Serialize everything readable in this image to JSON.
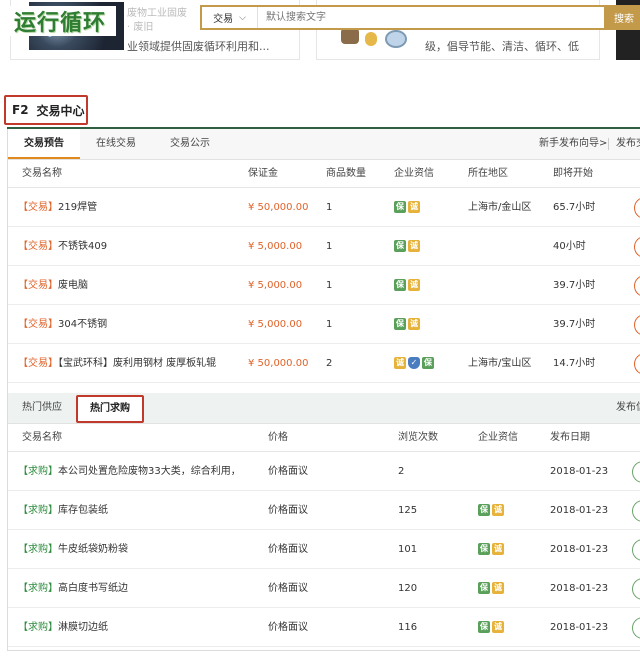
{
  "header": {
    "logo_text": "运行循环",
    "search": {
      "category": "交易",
      "placeholder": "默认搜索文字",
      "button": "搜索"
    },
    "cards": [
      {
        "faint1": "废物工业固废",
        "faint2": "·       废旧",
        "text": "业领域提供固废循环利用和..."
      },
      {
        "text": "级，倡导节能、清洁、循环、低"
      }
    ]
  },
  "section": {
    "code": "F2",
    "title": "交易中心"
  },
  "trade": {
    "tabs": [
      "交易预告",
      "在线交易",
      "交易公示"
    ],
    "right_links": [
      "新手发布向导>",
      "发布交"
    ],
    "columns": [
      "交易名称",
      "保证金",
      "商品数量",
      "企业资信",
      "所在地区",
      "即将开始"
    ],
    "rows": [
      {
        "tag": "【交易】",
        "name": "219焊管",
        "deposit": "¥ 50,000.00",
        "qty": "1",
        "badges": [
          "green",
          "gold"
        ],
        "region": "上海市/金山区",
        "start": "65.7小时"
      },
      {
        "tag": "【交易】",
        "name": "不锈铁409",
        "deposit": "¥ 5,000.00",
        "qty": "1",
        "badges": [
          "green",
          "gold"
        ],
        "region": "",
        "start": "40小时"
      },
      {
        "tag": "【交易】",
        "name": "废电脑",
        "deposit": "¥ 5,000.00",
        "qty": "1",
        "badges": [
          "green",
          "gold"
        ],
        "region": "",
        "start": "39.7小时"
      },
      {
        "tag": "【交易】",
        "name": "304不锈钢",
        "deposit": "¥ 5,000.00",
        "qty": "1",
        "badges": [
          "green",
          "gold"
        ],
        "region": "",
        "start": "39.7小时"
      },
      {
        "tag": "【交易】",
        "name": "【宝武环科】废利用钢材 废厚板轧辊",
        "deposit": "¥ 50,000.00",
        "qty": "2",
        "badges": [
          "gold",
          "shield",
          "green"
        ],
        "region": "上海市/宝山区",
        "start": "14.7小时"
      }
    ]
  },
  "hot": {
    "tabs": [
      "热门供应",
      "热门求购"
    ],
    "right_link": "发布信",
    "columns": [
      "交易名称",
      "价格",
      "浏览次数",
      "企业资信",
      "发布日期"
    ],
    "rows": [
      {
        "tag": "【求购】",
        "name": "本公司处置危险废物33大类，综合利用，",
        "price": "价格面议",
        "views": "2",
        "badges": [],
        "date": "2018-01-23"
      },
      {
        "tag": "【求购】",
        "name": "库存包装纸",
        "price": "价格面议",
        "views": "125",
        "badges": [
          "green",
          "gold"
        ],
        "date": "2018-01-23"
      },
      {
        "tag": "【求购】",
        "name": "牛皮纸袋奶粉袋",
        "price": "价格面议",
        "views": "101",
        "badges": [
          "green",
          "gold"
        ],
        "date": "2018-01-23"
      },
      {
        "tag": "【求购】",
        "name": "高白度书写纸边",
        "price": "价格面议",
        "views": "120",
        "badges": [
          "green",
          "gold"
        ],
        "date": "2018-01-23"
      },
      {
        "tag": "【求购】",
        "name": "淋膜切边纸",
        "price": "价格面议",
        "views": "116",
        "badges": [
          "green",
          "gold"
        ],
        "date": "2018-01-23"
      }
    ]
  },
  "badge_glyphs": {
    "green": "保",
    "gold": "诚",
    "shield": "✓"
  },
  "colors": {
    "accent": "#c39a4a",
    "trade_tag": "#e0632a",
    "buy_tag": "#2e8b3e",
    "section_line": "#2e5f41",
    "highlight_box": "#c0392b"
  }
}
